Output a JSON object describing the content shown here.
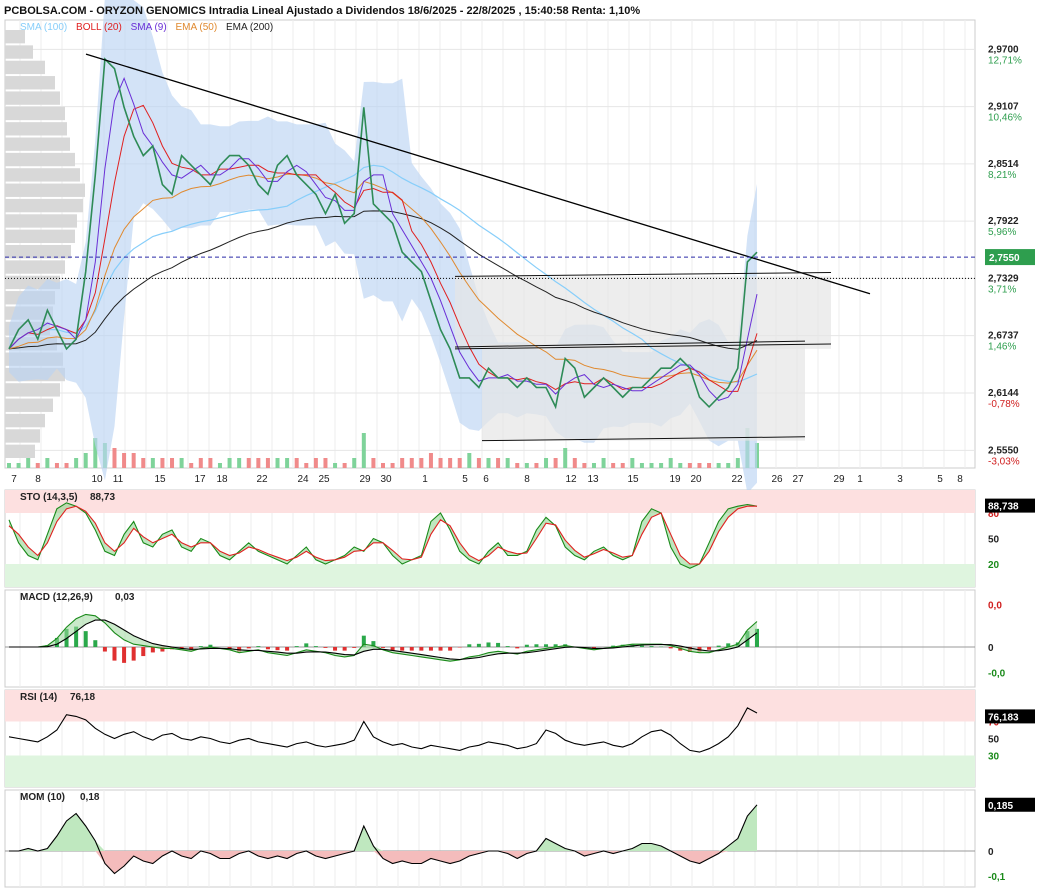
{
  "header": {
    "title": "PCBOLSA.COM - ORYZON GENOMICS Intradia Lineal Ajustado a Dividendos 18/6/2025 - 22/8/2025 , 15:40:58 Renta: 1,10%"
  },
  "legend": {
    "sma100": "SMA (100)",
    "boll": "BOLL (20)",
    "sma9": "SMA (9)",
    "ema50": "EMA (50)",
    "ema200": "EMA (200)"
  },
  "colors": {
    "price": "#2e8b57",
    "sma100": "#87cefa",
    "boll": "#e02020",
    "sma9": "#6a2fd6",
    "ema50": "#e08a30",
    "ema200": "#222222",
    "band": "#bcd4f2",
    "current": "#2e9e4e"
  },
  "chart_data": [
    {
      "type": "line",
      "panel": "price",
      "y_ticks": [
        {
          "price": "2,9700",
          "pct": "12,71%"
        },
        {
          "price": "2,9107",
          "pct": "10,46%"
        },
        {
          "price": "2,8514",
          "pct": "8,21%"
        },
        {
          "price": "2,7922",
          "pct": "5,96%"
        },
        {
          "price": "2,7329",
          "pct": "3,71%"
        },
        {
          "price": "2,6737",
          "pct": "1,46%"
        },
        {
          "price": "2,6144",
          "pct": "-0,78%"
        },
        {
          "price": "2,5550",
          "pct": "-3,03%"
        }
      ],
      "ylim": [
        2.545,
        2.99
      ],
      "current_price": "2,7550",
      "reference_price": 2.7329,
      "x_ticks": [
        "7",
        "8",
        "10",
        "11",
        "15",
        "17",
        "18",
        "22",
        "24",
        "25",
        "29",
        "30",
        "1",
        "5",
        "6",
        "8",
        "12",
        "13",
        "15",
        "19",
        "20",
        "22",
        "26",
        "27",
        "29",
        "1",
        "3",
        "5",
        "8"
      ],
      "close": [
        2.66,
        2.68,
        2.69,
        2.67,
        2.7,
        2.68,
        2.66,
        2.67,
        2.74,
        2.84,
        2.96,
        2.95,
        2.91,
        2.88,
        2.86,
        2.87,
        2.83,
        2.82,
        2.86,
        2.85,
        2.84,
        2.83,
        2.85,
        2.86,
        2.86,
        2.85,
        2.83,
        2.82,
        2.85,
        2.86,
        2.84,
        2.83,
        2.82,
        2.8,
        2.82,
        2.79,
        2.8,
        2.91,
        2.81,
        2.8,
        2.79,
        2.76,
        2.75,
        2.74,
        2.71,
        2.68,
        2.66,
        2.63,
        2.63,
        2.62,
        2.64,
        2.63,
        2.63,
        2.62,
        2.63,
        2.62,
        2.62,
        2.6,
        2.65,
        2.64,
        2.61,
        2.62,
        2.63,
        2.62,
        2.61,
        2.62,
        2.62,
        2.63,
        2.64,
        2.64,
        2.65,
        2.64,
        2.61,
        2.6,
        2.61,
        2.62,
        2.64,
        2.75,
        2.76
      ],
      "volume": [
        1,
        1,
        2,
        1,
        2,
        1,
        1,
        2,
        3,
        6,
        5,
        4,
        3,
        3,
        2,
        2,
        2,
        2,
        2,
        1,
        2,
        2,
        1,
        2,
        2,
        2,
        2,
        2,
        2,
        2,
        2,
        1,
        2,
        2,
        1,
        1,
        2,
        7,
        2,
        1,
        1,
        2,
        2,
        2,
        3,
        2,
        2,
        2,
        3,
        2,
        2,
        2,
        2,
        1,
        1,
        1,
        2,
        2,
        4,
        2,
        1,
        1,
        2,
        1,
        1,
        2,
        1,
        1,
        1,
        2,
        1,
        1,
        1,
        1,
        1,
        1,
        2,
        8,
        5
      ]
    },
    {
      "type": "line",
      "panel": "stochastic",
      "label": "STO (14,3,5)",
      "value_label": "88,73",
      "current": "88,738",
      "levels": [
        "80",
        "50",
        "20"
      ],
      "ylim": [
        0,
        100
      ],
      "k": [
        72,
        45,
        30,
        25,
        55,
        85,
        92,
        88,
        80,
        60,
        35,
        30,
        55,
        70,
        45,
        40,
        55,
        60,
        40,
        35,
        50,
        45,
        30,
        25,
        35,
        45,
        35,
        30,
        25,
        20,
        30,
        40,
        25,
        20,
        25,
        30,
        40,
        35,
        50,
        45,
        30,
        20,
        25,
        30,
        70,
        80,
        60,
        35,
        25,
        20,
        35,
        45,
        30,
        30,
        35,
        60,
        75,
        65,
        40,
        30,
        25,
        35,
        40,
        30,
        25,
        30,
        70,
        85,
        80,
        40,
        20,
        15,
        20,
        45,
        70,
        85,
        88,
        90,
        88
      ],
      "d": [
        65,
        55,
        40,
        30,
        45,
        70,
        85,
        88,
        82,
        68,
        45,
        35,
        45,
        62,
        52,
        45,
        50,
        55,
        45,
        40,
        45,
        45,
        35,
        30,
        33,
        40,
        37,
        32,
        28,
        24,
        28,
        35,
        28,
        24,
        25,
        28,
        35,
        36,
        45,
        45,
        36,
        26,
        25,
        28,
        55,
        72,
        65,
        45,
        30,
        24,
        30,
        40,
        35,
        32,
        33,
        50,
        68,
        66,
        48,
        36,
        28,
        32,
        37,
        33,
        28,
        30,
        55,
        75,
        80,
        55,
        30,
        20,
        20,
        35,
        58,
        75,
        85,
        88,
        88
      ]
    },
    {
      "type": "line",
      "panel": "macd",
      "label": "MACD (12,26,9)",
      "value_label": "0,03",
      "levels": [
        "0,0",
        "0",
        "-0,0"
      ],
      "ylim": [
        -1.2,
        1.8
      ],
      "macd": [
        0,
        0,
        0,
        0,
        0.05,
        0.3,
        0.7,
        1.0,
        1.15,
        1.1,
        0.85,
        0.5,
        0.25,
        0.1,
        0.05,
        0.0,
        -0.05,
        -0.05,
        -0.1,
        -0.15,
        -0.05,
        0.0,
        -0.05,
        -0.1,
        -0.2,
        -0.15,
        -0.1,
        -0.2,
        -0.25,
        -0.3,
        -0.2,
        -0.1,
        -0.15,
        -0.2,
        -0.3,
        -0.35,
        -0.3,
        0.1,
        0.05,
        -0.1,
        -0.2,
        -0.25,
        -0.3,
        -0.35,
        -0.4,
        -0.45,
        -0.5,
        -0.45,
        -0.35,
        -0.3,
        -0.2,
        -0.15,
        -0.2,
        -0.25,
        -0.15,
        -0.1,
        -0.05,
        0.0,
        0.05,
        0.0,
        -0.05,
        -0.1,
        -0.05,
        0.0,
        0.05,
        0.1,
        0.1,
        0.1,
        0.1,
        0.05,
        -0.05,
        -0.15,
        -0.2,
        -0.2,
        -0.1,
        0.0,
        0.1,
        0.6,
        0.9
      ],
      "signal": [
        0,
        0,
        0,
        0,
        0.01,
        0.1,
        0.3,
        0.55,
        0.8,
        0.95,
        0.95,
        0.8,
        0.6,
        0.4,
        0.25,
        0.12,
        0.05,
        0.0,
        -0.05,
        -0.08,
        -0.07,
        -0.05,
        -0.05,
        -0.06,
        -0.1,
        -0.12,
        -0.12,
        -0.15,
        -0.18,
        -0.22,
        -0.22,
        -0.18,
        -0.17,
        -0.18,
        -0.22,
        -0.27,
        -0.28,
        -0.15,
        -0.08,
        -0.08,
        -0.12,
        -0.17,
        -0.22,
        -0.27,
        -0.32,
        -0.37,
        -0.42,
        -0.44,
        -0.41,
        -0.37,
        -0.3,
        -0.24,
        -0.22,
        -0.22,
        -0.2,
        -0.16,
        -0.11,
        -0.06,
        -0.01,
        0.0,
        -0.02,
        -0.05,
        -0.05,
        -0.03,
        0.0,
        0.04,
        0.07,
        0.08,
        0.09,
        0.08,
        0.03,
        -0.04,
        -0.1,
        -0.14,
        -0.13,
        -0.08,
        0.0,
        0.25,
        0.5
      ]
    },
    {
      "type": "line",
      "panel": "rsi",
      "label": "RSI (14)",
      "value_label": "76,18",
      "current": "76,183",
      "levels": [
        "70",
        "50",
        "30"
      ],
      "ylim": [
        0,
        100
      ],
      "values": [
        52,
        50,
        48,
        46,
        52,
        60,
        78,
        76,
        72,
        62,
        55,
        50,
        55,
        58,
        52,
        48,
        54,
        56,
        50,
        48,
        52,
        50,
        46,
        44,
        48,
        50,
        46,
        44,
        42,
        40,
        44,
        46,
        42,
        40,
        42,
        44,
        48,
        70,
        52,
        46,
        42,
        44,
        40,
        38,
        42,
        40,
        38,
        36,
        40,
        42,
        46,
        44,
        42,
        38,
        40,
        44,
        60,
        56,
        48,
        44,
        42,
        44,
        46,
        42,
        40,
        44,
        52,
        58,
        60,
        54,
        44,
        36,
        34,
        38,
        44,
        52,
        65,
        86,
        80
      ]
    },
    {
      "type": "area",
      "panel": "momentum",
      "label": "MOM (10)",
      "value_label": "0,18",
      "current": "0,185",
      "levels": [
        "0,2",
        "0",
        "-0,1"
      ],
      "ylim": [
        -0.12,
        0.22
      ],
      "values": [
        0,
        0,
        0.01,
        0.0,
        0.01,
        0.06,
        0.12,
        0.15,
        0.1,
        0.04,
        -0.05,
        -0.09,
        -0.06,
        -0.02,
        -0.04,
        -0.05,
        -0.02,
        0.0,
        -0.02,
        -0.03,
        0.0,
        -0.01,
        -0.03,
        -0.03,
        -0.01,
        0.0,
        -0.02,
        -0.03,
        -0.02,
        -0.03,
        -0.01,
        0.0,
        -0.02,
        -0.03,
        -0.02,
        -0.01,
        0.0,
        0.1,
        0.02,
        -0.03,
        -0.05,
        -0.04,
        -0.05,
        -0.05,
        -0.03,
        -0.04,
        -0.05,
        -0.04,
        -0.02,
        -0.01,
        0.0,
        0.0,
        -0.01,
        -0.03,
        -0.01,
        0.0,
        0.05,
        0.03,
        0.01,
        0.0,
        -0.02,
        -0.01,
        0.0,
        -0.01,
        0.0,
        0.01,
        0.03,
        0.03,
        0.02,
        0.0,
        -0.02,
        -0.04,
        -0.05,
        -0.03,
        -0.01,
        0.02,
        0.05,
        0.14,
        0.185
      ]
    }
  ]
}
